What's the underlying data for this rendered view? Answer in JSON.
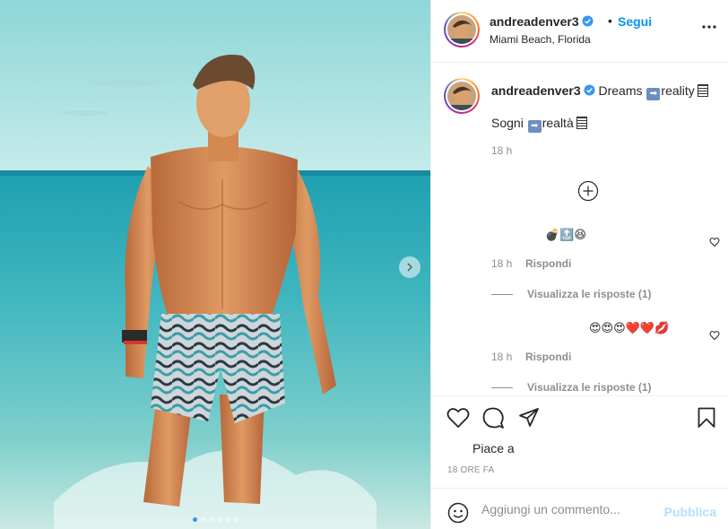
{
  "post": {
    "username": "andreadenver3",
    "follow_separator": "•",
    "follow_label": "Segui",
    "location": "Miami Beach, Florida",
    "more_icon": "more-dots-icon"
  },
  "caption": {
    "username": "andreadenver3",
    "line1_pre": "Dreams",
    "line1_post": "reality",
    "line2_pre": "Sogni",
    "line2_post": "realtà",
    "time": "18 h"
  },
  "comments": [
    {
      "text": "💣🔝😆",
      "time": "18 h",
      "reply_label": "Rispondi",
      "view_replies": "Visualizza le risposte (1)"
    },
    {
      "text": "😍😍😍❤️❤️💋",
      "time": "18 h",
      "reply_label": "Rispondi",
      "view_replies": "Visualizza le risposte (1)"
    }
  ],
  "actions": {
    "icons": [
      "heart-icon",
      "comment-icon",
      "share-icon",
      "save-icon"
    ],
    "likes_text": "Piace a",
    "posted_time": "18 ORE FA"
  },
  "comment_box": {
    "placeholder": "Aggiungi un commento...",
    "publish_label": "Pubblica"
  },
  "colors": {
    "accent": "#0095f6",
    "publish_disabled": "#b2dffc",
    "muted": "#8e8e8e"
  },
  "carousel": {
    "total_slides": 6,
    "current_slide": 1
  }
}
